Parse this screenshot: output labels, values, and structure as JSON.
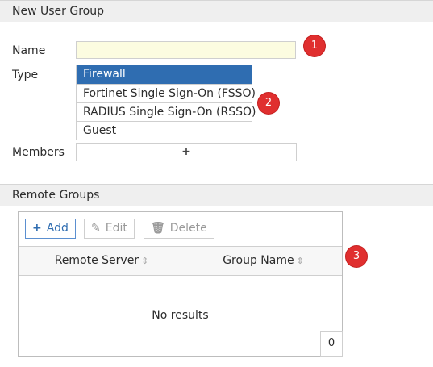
{
  "header": {
    "title": "New User Group"
  },
  "form": {
    "name_label": "Name",
    "name_value": "",
    "type_label": "Type",
    "type_options": [
      {
        "label": "Firewall",
        "selected": true
      },
      {
        "label": "Fortinet Single Sign-On (FSSO)",
        "selected": false
      },
      {
        "label": "RADIUS Single Sign-On (RSSO)",
        "selected": false
      },
      {
        "label": "Guest",
        "selected": false
      }
    ],
    "members_label": "Members",
    "members_add": "+"
  },
  "badges": [
    "1",
    "2",
    "3"
  ],
  "remote_groups": {
    "title": "Remote Groups",
    "buttons": {
      "add": "Add",
      "edit": "Edit",
      "delete": "Delete"
    },
    "columns": [
      "Remote Server",
      "Group Name"
    ],
    "empty_text": "No results",
    "count": "0"
  },
  "colors": {
    "selected_bg": "#2f6db1",
    "badge_red": "#e02f2f",
    "name_input_bg": "#fcfce0"
  },
  "icons": {
    "add": "plus-icon",
    "edit": "pencil-icon",
    "delete": "trash-icon",
    "sort": "sort-icon"
  }
}
